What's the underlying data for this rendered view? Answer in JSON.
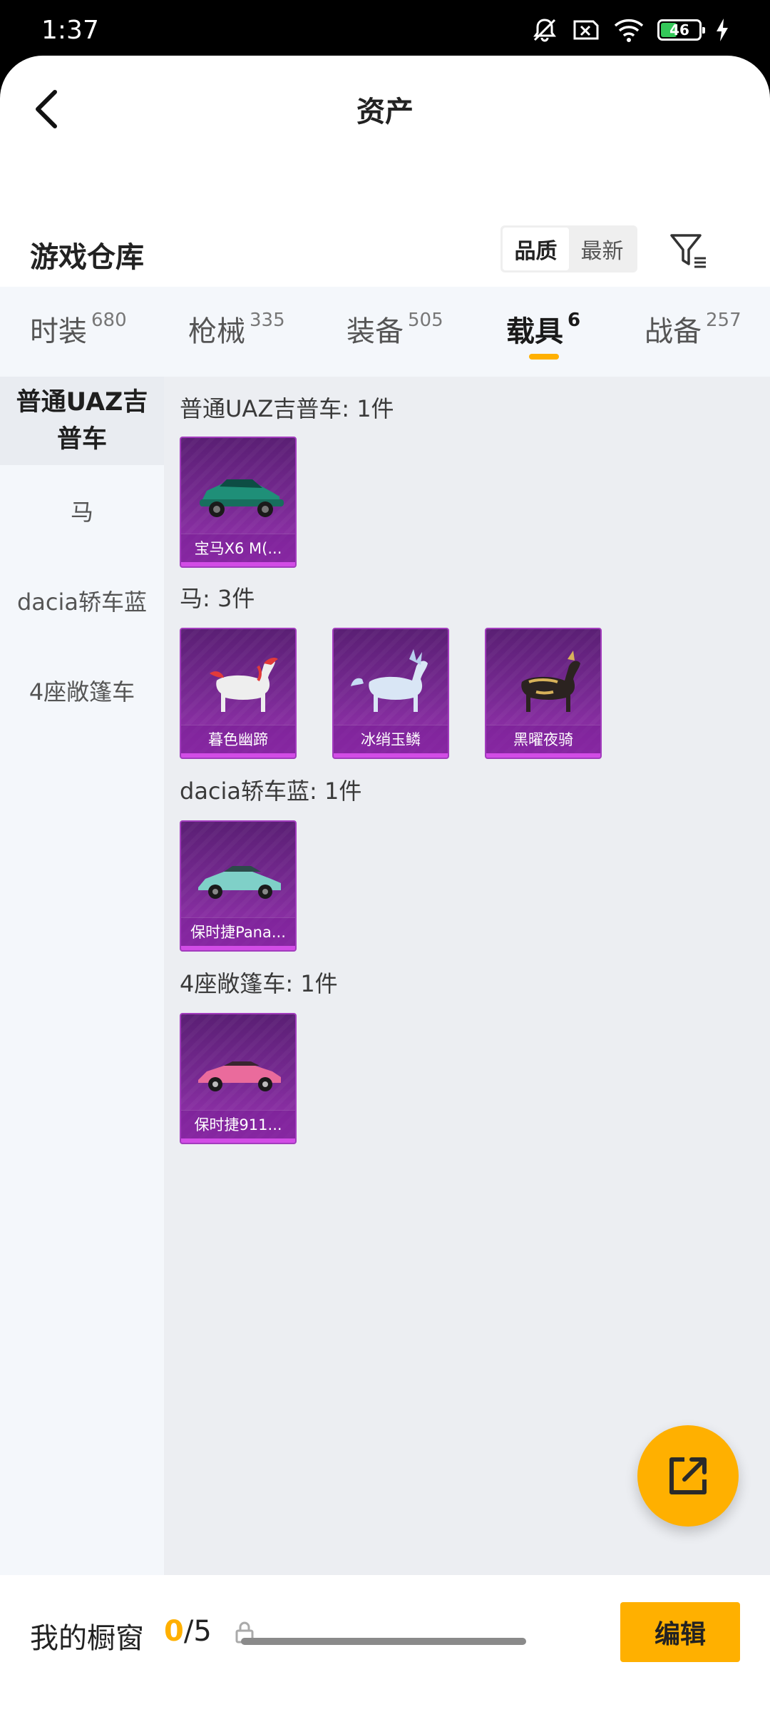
{
  "status_bar": {
    "time": "1:37",
    "battery": "46",
    "icons": [
      "mute-bell-icon",
      "sim-x-icon",
      "wifi-icon",
      "battery-icon",
      "charging-icon"
    ]
  },
  "header": {
    "title": "资产",
    "back_icon": "chevron-left-icon"
  },
  "warehouse": {
    "title": "游戏仓库",
    "sort_options": [
      "品质",
      "最新"
    ],
    "sort_selected": "品质",
    "filter_icon": "filter-list-icon"
  },
  "tabs": [
    {
      "label": "时装",
      "count": "680"
    },
    {
      "label": "枪械",
      "count": "335"
    },
    {
      "label": "装备",
      "count": "505"
    },
    {
      "label": "载具",
      "count": "6",
      "active": true
    },
    {
      "label": "战备",
      "count": "257"
    }
  ],
  "sidebar": {
    "items": [
      {
        "label": "普通UAZ吉普车",
        "active": true
      },
      {
        "label": "马"
      },
      {
        "label": "dacia轿车蓝"
      },
      {
        "label": "4座敞篷车"
      }
    ]
  },
  "groups": [
    {
      "title": "普通UAZ吉普车: 1件",
      "items": [
        {
          "name": "宝马X6 M(...",
          "icon": "green-suv-icon"
        }
      ]
    },
    {
      "title": "马: 3件",
      "items": [
        {
          "name": "暮色幽蹄",
          "icon": "red-white-horse-icon"
        },
        {
          "name": "冰绡玉鳞",
          "icon": "ice-horse-icon"
        },
        {
          "name": "黑曜夜骑",
          "icon": "black-gold-horse-icon"
        }
      ]
    },
    {
      "title": "dacia轿车蓝: 1件",
      "items": [
        {
          "name": "保时捷Pana...",
          "icon": "teal-sedan-icon"
        }
      ]
    },
    {
      "title": "4座敞篷车: 1件",
      "items": [
        {
          "name": "保时捷911...",
          "icon": "pink-sportscar-icon"
        }
      ]
    }
  ],
  "fab": {
    "icon": "share-external-icon"
  },
  "footer": {
    "label": "我的橱窗",
    "used": "0",
    "sep": "/",
    "total": "5",
    "lock_icon": "lock-icon",
    "edit_label": "编辑"
  },
  "colors": {
    "accent": "#ffb000",
    "card_purple": "#7a2a95"
  }
}
